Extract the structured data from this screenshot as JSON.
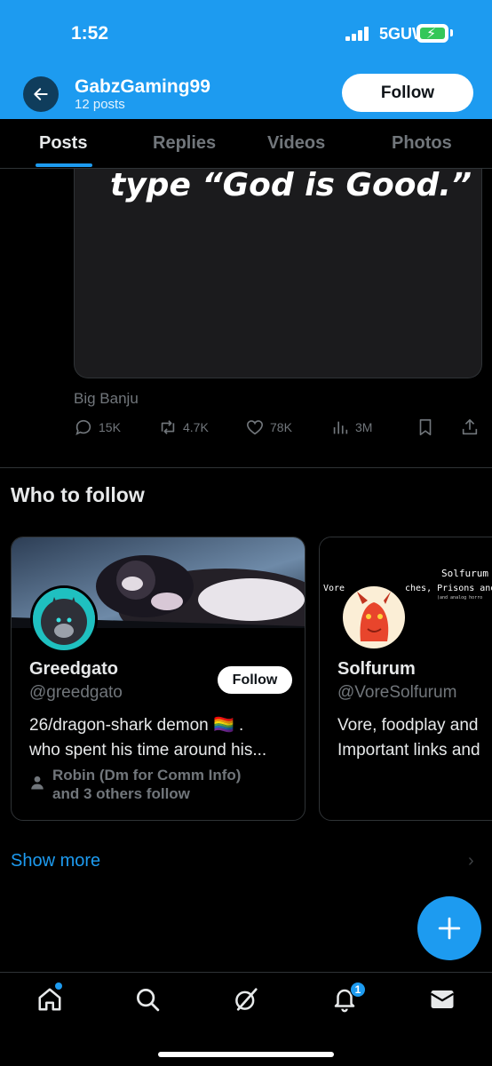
{
  "status_bar": {
    "time": "1:52",
    "network": "5GUW"
  },
  "header": {
    "username": "GabzGaming99",
    "posts": "12 posts",
    "follow_label": "Follow"
  },
  "tabs": [
    {
      "label": "Posts"
    },
    {
      "label": "Replies"
    },
    {
      "label": "Videos"
    },
    {
      "label": "Photos"
    }
  ],
  "post": {
    "media_text": "type “God is Good.”",
    "source": "Big Banju",
    "replies": "15K",
    "reposts": "4.7K",
    "likes": "78K",
    "views": "3M"
  },
  "who_to_follow": {
    "title": "Who to follow",
    "cards": [
      {
        "name": "Greedgato",
        "handle": "@greedgato",
        "bio_line1": "26/dragon-shark demon 🏳️‍🌈 .",
        "bio_line2": "who spent his time around his...",
        "follow_label": "Follow",
        "social_line1": "Robin (Dm for Comm Info)",
        "social_line2": "and 3 others follow"
      },
      {
        "name": "Solfurum",
        "handle": "@VoreSolfurum",
        "bio_line1": "Vore, foodplay and",
        "bio_line2": "Important links and",
        "banner_text_1": "Solfurum",
        "banner_text_2": "Vore",
        "banner_text_3": "ches, Prisons and",
        "banner_text_4": "(and analog horro"
      }
    ],
    "show_more": "Show more"
  },
  "nav": {
    "notifications_badge": "1"
  },
  "colors": {
    "accent": "#1d9bf0",
    "background": "#000000",
    "muted": "#71767b"
  }
}
